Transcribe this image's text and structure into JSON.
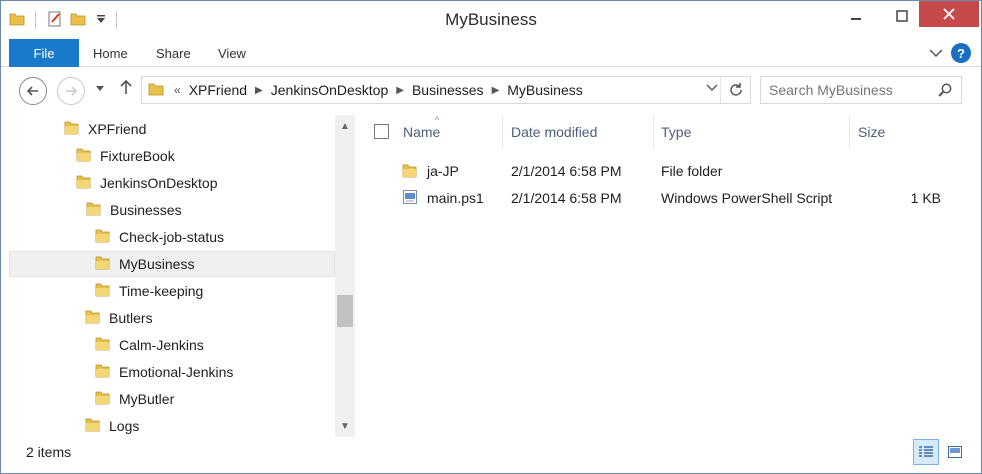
{
  "window": {
    "title": "MyBusiness"
  },
  "quick_access": {
    "icons": [
      "folder-icon",
      "properties-icon",
      "new-folder-icon",
      "customize-dropdown-icon"
    ]
  },
  "window_controls": {
    "minimize": "–",
    "maximize": "☐",
    "close": "✕"
  },
  "ribbon": {
    "tabs": [
      {
        "label": "File"
      },
      {
        "label": "Home"
      },
      {
        "label": "Share"
      },
      {
        "label": "View"
      }
    ],
    "expand_glyph": "⌄",
    "help_label": "?"
  },
  "nav": {
    "back": "←",
    "forward": "→",
    "recent": "▾",
    "up": "↑"
  },
  "address": {
    "overflow": "«",
    "crumbs": [
      "XPFriend",
      "JenkinsOnDesktop",
      "Businesses",
      "MyBusiness"
    ],
    "separator": "▶",
    "dropdown": "⌄",
    "refresh": "↻"
  },
  "search": {
    "placeholder": "Search MyBusiness",
    "icon": "search-icon"
  },
  "nav_pane": {
    "items": [
      {
        "label": "XPFriend",
        "level": 0
      },
      {
        "label": "FixtureBook",
        "level": 1
      },
      {
        "label": "JenkinsOnDesktop",
        "level": 1
      },
      {
        "label": "Businesses",
        "level": 2
      },
      {
        "label": "Check-job-status",
        "level": 3
      },
      {
        "label": "MyBusiness",
        "level": 3,
        "selected": true
      },
      {
        "label": "Time-keeping",
        "level": 3
      },
      {
        "label": "Butlers",
        "level": 2
      },
      {
        "label": "Calm-Jenkins",
        "level": 3
      },
      {
        "label": "Emotional-Jenkins",
        "level": 3
      },
      {
        "label": "MyButler",
        "level": 3
      },
      {
        "label": "Logs",
        "level": 2
      }
    ],
    "scroll_up": "▲",
    "scroll_down": "▼"
  },
  "columns": {
    "name": "Name",
    "date": "Date modified",
    "type": "Type",
    "size": "Size",
    "sort_glyph": "^"
  },
  "files": [
    {
      "name": "ja-JP",
      "date": "2/1/2014 6:58 PM",
      "type": "File folder",
      "size": "",
      "icon": "folder-icon"
    },
    {
      "name": "main.ps1",
      "date": "2/1/2014 6:58 PM",
      "type": "Windows PowerShell Script",
      "size": "1 KB",
      "icon": "script-file-icon"
    }
  ],
  "status": {
    "item_count": "2 items"
  },
  "colors": {
    "accent": "#1979ca",
    "close": "#c74a4a",
    "folder": "#e8c04a"
  }
}
